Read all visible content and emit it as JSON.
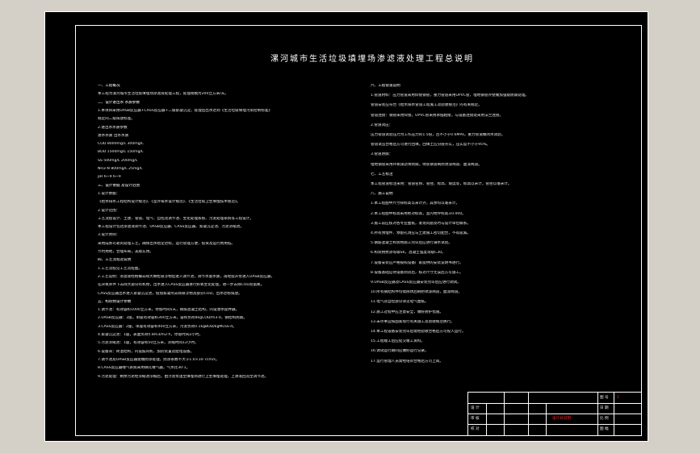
{
  "title": "漯河城市生活垃圾填埋场渗滤液处理工程总说明",
  "left": [
    {
      "text": "一、工程概况",
      "h": true
    },
    {
      "text": "本工程为漯河城市生活垃圾填埋场渗滤液处理工程，处理规模为200立方米/天。"
    },
    {
      "text": "二、设计进出水 水质参数",
      "h": true
    },
    {
      "text": "1.本项目采用UASB反应器+CASS反应器+二级絮凝沉淀，处理后出水达到《生活垃圾填埋污染控制标准》"
    },
    {
      "text": "   规定的二级排放标准。"
    },
    {
      "text": "2.进出水水质参数"
    },
    {
      "text": "          进水水质            出水水质"
    },
    {
      "text": "COD       8000mg/L            300mg/L"
    },
    {
      "text": "BOD       1500mg/L            150mg/L"
    },
    {
      "text": "SS        500mg/L             200mg/L"
    },
    {
      "text": "NH3-N     800mg/L             25mg/L"
    },
    {
      "text": "pH        6~9                 6~9"
    },
    {
      "text": "三、设计依据 及设计范围",
      "h": true
    },
    {
      "text": "1.设计依据："
    },
    {
      "text": "   《给水排水工程结构设计规范》、《室外排水设计规范》、《生活垃圾卫生填埋技术规范》。"
    },
    {
      "text": "2.设计范围："
    },
    {
      "text": "   工艺流程设计、土建、管道、电气、自控及调节池、生化处理系统、污泥处理系统等工程设计。"
    },
    {
      "text": "   本工程设计包括渗滤液调节池、UASB反应器、CASS反应器、絮凝沉淀池、污泥浓缩池。"
    },
    {
      "text": "3.设计原则："
    },
    {
      "text": "   采用成熟可靠的处理工艺，确保出水稳定达标，运行管理方便，投资及运行费用低。"
    },
    {
      "text": "   节约用地，合理布局，美观实用。"
    },
    {
      "text": "四、工艺流程及说明",
      "h": true
    },
    {
      "text": "1.工艺流程见工艺流程图。"
    },
    {
      "text": "2.工艺说明：渗滤液经格栅去除大颗粒悬浮物后进入调节池，调节水量水质，再经提升泵进入UASB反应器，"
    },
    {
      "text": "   在厌氧条件下去除大部分有机物，出水进入CASS反应器进行好氧生化处理，进一步去除COD及氨氮。"
    },
    {
      "text": "   CASS反应器出水进入絮凝沉淀池，投加絮凝剂去除悬浮物及部分COD，出水达标排放。"
    },
    {
      "text": "五、构筑物设计参数",
      "h": true
    },
    {
      "text": "1.调节池：有效容积1000立方米，停留时间5天，钢筋混凝土结构，内设潜水搅拌器。"
    },
    {
      "text": "2.UASB反应器：2座，单座有效容积300立方米，容积负荷8kgCOD/m3·d，钢结构防腐。"
    },
    {
      "text": "3.CASS反应器：2座，单座有效容积400立方米，污泥负荷0.1kgBOD/kgMLSS·d。"
    },
    {
      "text": "4.絮凝沉淀池：1座，表面负荷0.8m3/m2·h，停留时间2小时。"
    },
    {
      "text": "5.污泥浓缩池：1座，有效容积50立方米，浓缩时间12小时。"
    },
    {
      "text": "6.设备间：砖混结构，内设鼓风机、加药装置及配电设备。"
    },
    {
      "text": "7.调节池及UASB反应器需做防渗处理，防渗系数不大于1.0×10-7cm/s。"
    },
    {
      "text": "8.CASS反应器曝气系统采用微孔曝气器，气水比30:1。"
    },
    {
      "text": "9.污泥处理：剩余污泥经浓缩池浓缩后，由污泥泵送至填埋场进行卫生填埋处理，上清液回流至调节池。"
    }
  ],
  "right": [
    {
      "text": "六、工程管道说明",
      "h": true
    },
    {
      "text": "1.管道材料：压力管道采用焊接钢管，重力管道采用UPVC管，埋地钢管外壁做加强级防腐处理。"
    },
    {
      "text": "   管道安装应符合《给水排水管道工程施工及验收规范》的有关规定。"
    },
    {
      "text": "   管道连接：钢管采用焊接，UPVC管采用承插粘接，与设备连接处采用法兰连接。"
    },
    {
      "text": "2.管道试压："
    },
    {
      "text": "   压力管道试验压力为工作压力的1.5倍，且不小于0.6MPa，重力管道做闭水试验。"
    },
    {
      "text": "   管道试压合格后方可进行回填，回填土应分层夯实，压实度不小于95%。"
    },
    {
      "text": "3.管道防腐："
    },
    {
      "text": "   埋地钢管采用环氧煤沥青防腐，明装钢管刷防锈漆两道、面漆两道。"
    },
    {
      "text": "七、工艺标注",
      "h": true
    },
    {
      "text": "   本工程管道标注采用：管道名称、管径、标高、坡度等，标高以米计，管径以毫米计。"
    },
    {
      "text": "八、施工说明",
      "h": true
    },
    {
      "text": "1.本工程图中尺寸除标高以米计外，其余均以毫米计。"
    },
    {
      "text": "2.本工程图中标高采用绝对标高，室内地坪标高±0.000。"
    },
    {
      "text": "3.施工前应核对各专业图纸，发现问题及时与设计单位联系。"
    },
    {
      "text": "4.所有预埋件、预留孔洞应与土建施工密切配合，不得遗漏。"
    },
    {
      "text": "5.钢筋混凝土构筑物施工完毕后应进行满水试验。"
    },
    {
      "text": "6.构筑物抗渗等级S6，混凝土强度等级C30。"
    },
    {
      "text": "7.设备安装应严格按照设备厂家提供的安装说明书进行。"
    },
    {
      "text": "8.设备基础应待设备到货后，核对尺寸无误后方可施工。"
    },
    {
      "text": "9.UASB反应器及CASS反应器安装完毕后应进行调试。"
    },
    {
      "text": "10.所有钢结构件均需除锈后刷防锈漆两道，面漆两道。"
    },
    {
      "text": "11.电气及自控部分详见电气图纸。"
    },
    {
      "text": "12.施工过程中应注意安全，做好防护措施。"
    },
    {
      "text": "13.未尽事宜按国家现行有关施工及验收规范执行。"
    },
    {
      "text": "14.本工程设备安装完毕后需经验收合格后方可投入运行。"
    },
    {
      "text": "15.工程竣工后应提交竣工资料。"
    },
    {
      "text": "16.调试运行期间应做好运行记录。"
    },
    {
      "text": "17.运行管理人员需经培训合格后方可上岗。"
    }
  ],
  "title_block": {
    "drawing_name": "设计总说明",
    "rows": [
      {
        "a": "设 计",
        "b": "",
        "c": "",
        "d": ""
      },
      {
        "a": "审 核",
        "b": "",
        "c": "",
        "d": ""
      },
      {
        "a": "校 对",
        "b": "",
        "c": "",
        "d": ""
      },
      {
        "a": "制 图",
        "b": "",
        "c": "",
        "d": ""
      }
    ],
    "right_rows": [
      {
        "k": "图 号",
        "v": "1"
      },
      {
        "k": "日 期",
        "v": ""
      },
      {
        "k": "比 例",
        "v": ""
      },
      {
        "k": "图 幅",
        "v": ""
      }
    ]
  },
  "colors": {
    "background": "#000000",
    "line": "#ffffff",
    "accent": "#ff2020"
  }
}
